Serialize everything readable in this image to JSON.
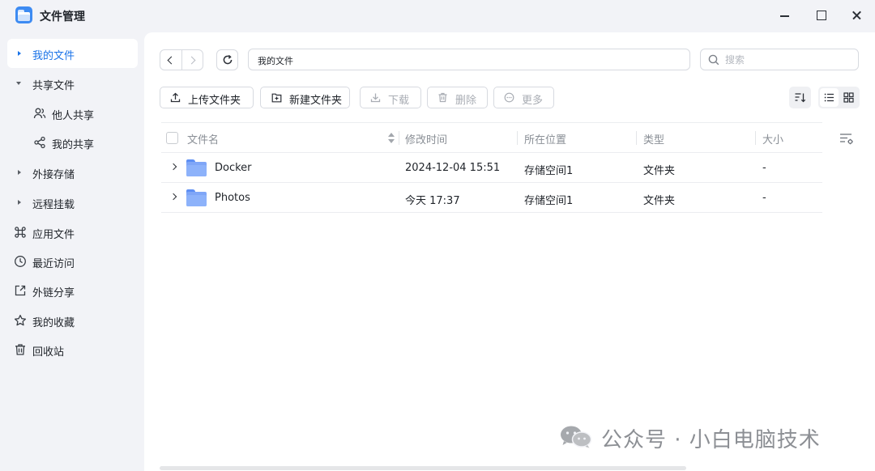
{
  "window": {
    "title": "文件管理"
  },
  "sidebar": {
    "items": [
      {
        "label": "我的文件",
        "icon": "caret-right-icon",
        "active": true
      },
      {
        "label": "共享文件",
        "icon": "caret-down-icon",
        "expanded": true
      },
      {
        "label": "他人共享",
        "icon": "users-icon",
        "child": true
      },
      {
        "label": "我的共享",
        "icon": "share-icon",
        "child": true
      },
      {
        "label": "外接存储",
        "icon": "caret-right-icon"
      },
      {
        "label": "远程挂载",
        "icon": "caret-right-icon"
      },
      {
        "label": "应用文件",
        "icon": "command-icon"
      },
      {
        "label": "最近访问",
        "icon": "clock-icon"
      },
      {
        "label": "外链分享",
        "icon": "external-link-icon"
      },
      {
        "label": "我的收藏",
        "icon": "star-icon"
      },
      {
        "label": "回收站",
        "icon": "trash-icon"
      }
    ]
  },
  "addressbar": {
    "path": "我的文件",
    "search_placeholder": "搜索"
  },
  "toolbar": {
    "upload": "上传文件夹",
    "new_folder": "新建文件夹",
    "download": "下载",
    "delete": "删除",
    "more": "更多"
  },
  "table": {
    "columns": [
      "文件名",
      "修改时间",
      "所在位置",
      "类型",
      "大小"
    ],
    "rows": [
      {
        "name": "Docker",
        "modified": "2024-12-04 15:51",
        "location": "存储空间1",
        "type": "文件夹",
        "size": "-"
      },
      {
        "name": "Photos",
        "modified": "今天 17:37",
        "location": "存储空间1",
        "type": "文件夹",
        "size": "-"
      }
    ]
  },
  "watermark": {
    "text": "公众号 · 小白电脑技术"
  },
  "colors": {
    "accent": "#1a73e8",
    "folder": "#7fa6f7",
    "app_icon": "#3d8bf2",
    "background": "#f2f3f7"
  }
}
